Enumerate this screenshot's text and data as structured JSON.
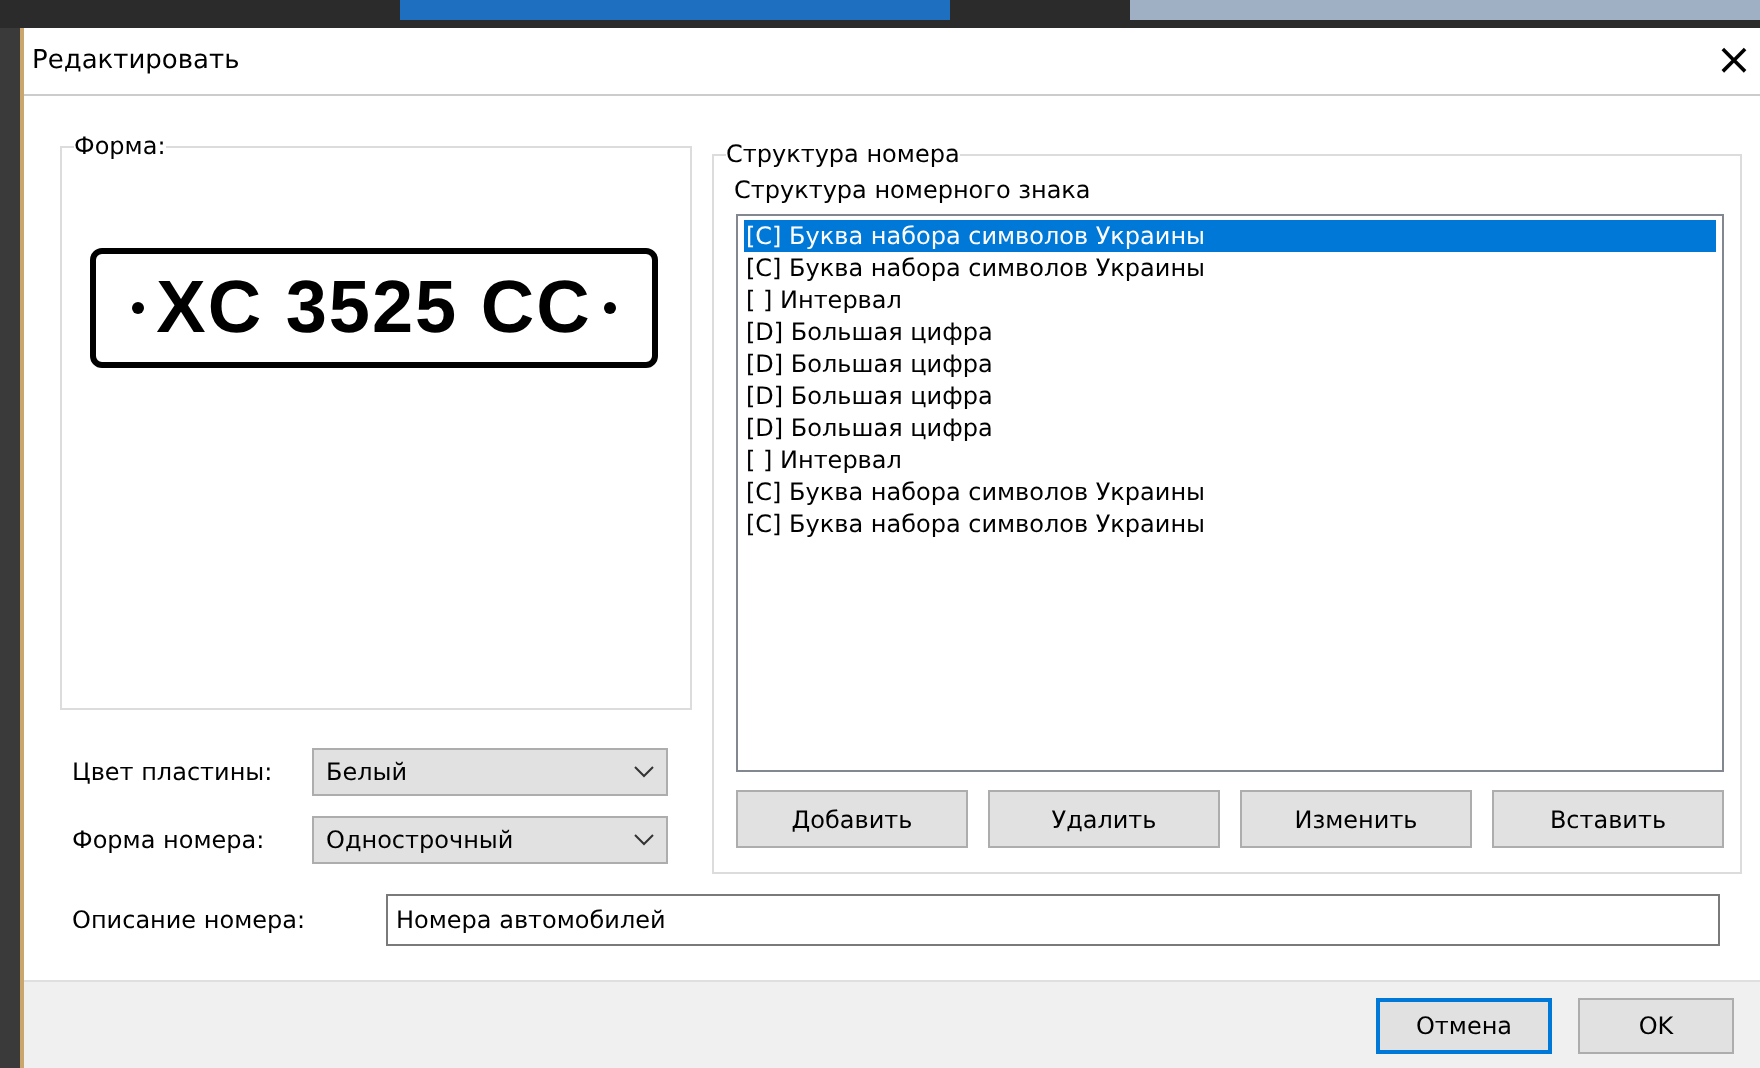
{
  "window": {
    "title": "Редактировать",
    "close": "×"
  },
  "shape_group": {
    "legend": "Форма:",
    "plate_text": "XC 3525 CC"
  },
  "plate_color": {
    "label": "Цвет пластины:",
    "value": "Белый"
  },
  "number_shape": {
    "label": "Форма номера:",
    "value": "Однострочный"
  },
  "structure_group": {
    "legend": "Структура номера",
    "list_label": "Структура номерного знака",
    "items": [
      {
        "text": "[C] Буква набора символов Украины",
        "selected": true
      },
      {
        "text": "[C] Буква набора символов Украины",
        "selected": false
      },
      {
        "text": "[ ] Интервал",
        "selected": false
      },
      {
        "text": "[D] Большая цифра",
        "selected": false
      },
      {
        "text": "[D] Большая цифра",
        "selected": false
      },
      {
        "text": "[D] Большая цифра",
        "selected": false
      },
      {
        "text": "[D] Большая цифра",
        "selected": false
      },
      {
        "text": "[ ] Интервал",
        "selected": false
      },
      {
        "text": "[C] Буква набора символов Украины",
        "selected": false
      },
      {
        "text": "[C] Буква набора символов Украины",
        "selected": false
      }
    ],
    "buttons": [
      "Добавить",
      "Удалить",
      "Изменить",
      "Вставить"
    ]
  },
  "description": {
    "label": "Описание номера:",
    "value": "Номера автомобилей"
  },
  "footer_buttons": [
    {
      "label": "Отмена",
      "focused": true
    },
    {
      "label": "OK",
      "focused": false
    }
  ]
}
